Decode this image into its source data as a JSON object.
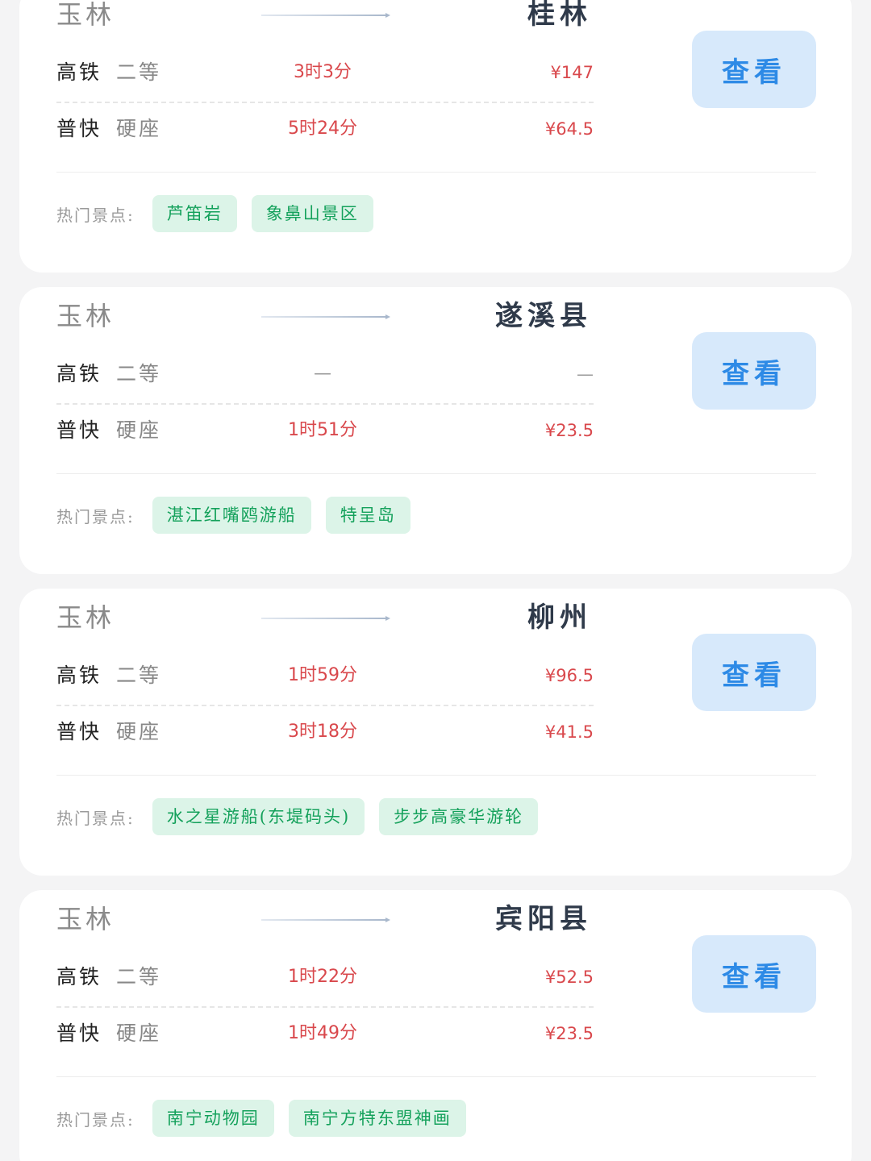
{
  "routes": [
    {
      "origin": "玉林",
      "destination": "桂林",
      "trains": [
        {
          "train_type": "高铁",
          "seat_type": "二等",
          "duration": "3时3分",
          "price": "¥147"
        },
        {
          "train_type": "普快",
          "seat_type": "硬座",
          "duration": "5时24分",
          "price": "¥64.5"
        }
      ],
      "view_label": "查看",
      "spots_label": "热门景点:",
      "spots": [
        "芦笛岩",
        "象鼻山景区"
      ]
    },
    {
      "origin": "玉林",
      "destination": "遂溪县",
      "trains": [
        {
          "train_type": "高铁",
          "seat_type": "二等",
          "duration": "—",
          "price": "—"
        },
        {
          "train_type": "普快",
          "seat_type": "硬座",
          "duration": "1时51分",
          "price": "¥23.5"
        }
      ],
      "view_label": "查看",
      "spots_label": "热门景点:",
      "spots": [
        "湛江红嘴鸥游船",
        "特呈岛"
      ]
    },
    {
      "origin": "玉林",
      "destination": "柳州",
      "trains": [
        {
          "train_type": "高铁",
          "seat_type": "二等",
          "duration": "1时59分",
          "price": "¥96.5"
        },
        {
          "train_type": "普快",
          "seat_type": "硬座",
          "duration": "3时18分",
          "price": "¥41.5"
        }
      ],
      "view_label": "查看",
      "spots_label": "热门景点:",
      "spots": [
        "水之星游船(东堤码头)",
        "步步高豪华游轮"
      ]
    },
    {
      "origin": "玉林",
      "destination": "宾阳县",
      "trains": [
        {
          "train_type": "高铁",
          "seat_type": "二等",
          "duration": "1时22分",
          "price": "¥52.5"
        },
        {
          "train_type": "普快",
          "seat_type": "硬座",
          "duration": "1时49分",
          "price": "¥23.5"
        }
      ],
      "view_label": "查看",
      "spots_label": "热门景点:",
      "spots": [
        "南宁动物园",
        "南宁方特东盟神画"
      ]
    }
  ],
  "colors": {
    "price": "#d9484c",
    "view_button_bg": "#d7e9fb",
    "view_button_text": "#2d8ae6",
    "tag_bg": "#dcf4e8",
    "tag_text": "#14a15b"
  },
  "icons": {
    "route_arrow": "right-arrow-icon"
  }
}
